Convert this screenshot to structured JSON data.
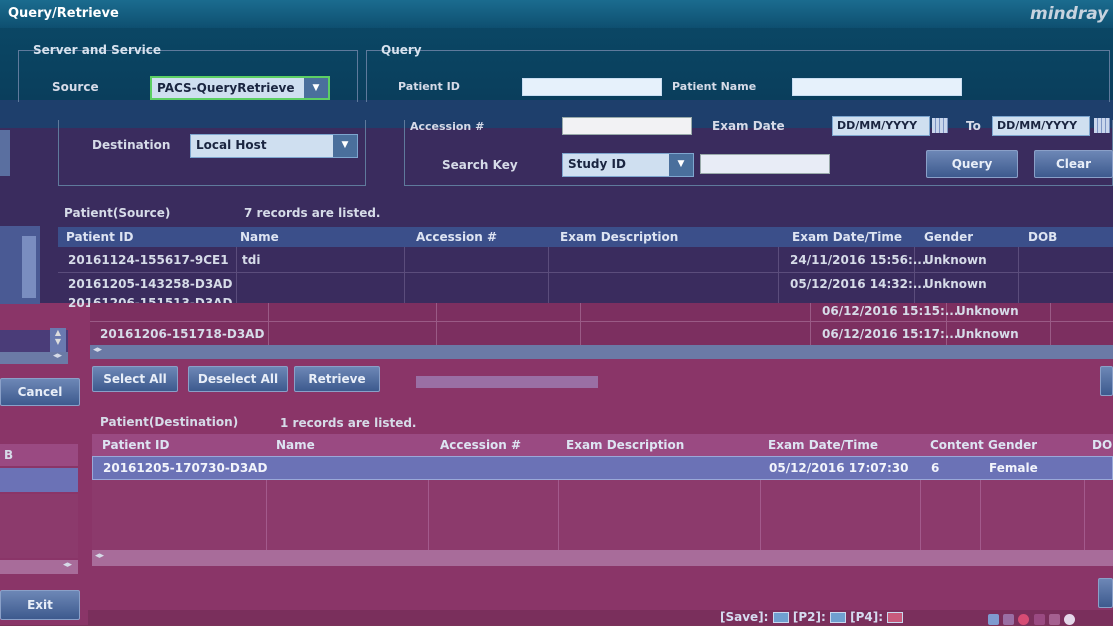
{
  "app": {
    "title": "Query/Retrieve",
    "brand": "mindray"
  },
  "server": {
    "legend": "Server and Service",
    "source_label": "Source",
    "source_value": "PACS-QueryRetrieve",
    "destination_label": "Destination",
    "destination_value": "Local Host"
  },
  "query": {
    "legend": "Query",
    "patient_id_label": "Patient ID",
    "patient_name_label": "Patient Name",
    "accession_label": "Accession #",
    "exam_date_label": "Exam Date",
    "date_from": "DD/MM/YYYY",
    "to_label": "To",
    "date_to": "DD/MM/YYYY",
    "search_key_label": "Search Key",
    "search_key_value": "Study ID",
    "query_button": "Query",
    "clear_button": "Clear"
  },
  "source_table": {
    "title": "Patient(Source)",
    "count": "7 records are listed.",
    "columns": [
      "Patient ID",
      "Name",
      "Accession #",
      "Exam Description",
      "Exam Date/Time",
      "Gender",
      "DOB"
    ],
    "rows": [
      {
        "id": "20161124-155617-9CE1",
        "name": "tdi",
        "datetime": "24/11/2016 15:56:...",
        "gender": "Unknown"
      },
      {
        "id": "20161205-143258-D3AD",
        "name": "",
        "datetime": "05/12/2016 14:32:...",
        "gender": "Unknown"
      },
      {
        "id": "20161206-151513-D3AD",
        "name": "",
        "datetime": "06/12/2016 15:15:...",
        "gender": "Unknown"
      },
      {
        "id": "20161206-151718-D3AD",
        "name": "",
        "datetime": "06/12/2016 15:17:...",
        "gender": "Unknown"
      }
    ]
  },
  "actions": {
    "select_all": "Select All",
    "deselect_all": "Deselect All",
    "retrieve": "Retrieve",
    "cancel": "Cancel",
    "exit": "Exit"
  },
  "dest_table": {
    "title": "Patient(Destination)",
    "count": "1 records are listed.",
    "columns": [
      "Patient ID",
      "Name",
      "Accession #",
      "Exam Description",
      "Exam Date/Time",
      "Content",
      "Gender",
      "DO"
    ],
    "rows": [
      {
        "id": "20161205-170730-D3AD",
        "datetime": "05/12/2016 17:07:30",
        "content": "6",
        "gender": "Female"
      }
    ]
  },
  "statusbar": {
    "save": "[Save]:",
    "p2": "[P2]:",
    "p4": "[P4]:"
  },
  "colors": {
    "title_bar": "#1b6c8f",
    "header": "#3b4f8a",
    "selected_row": "#6b72b6",
    "brand": "#c7d3df"
  }
}
